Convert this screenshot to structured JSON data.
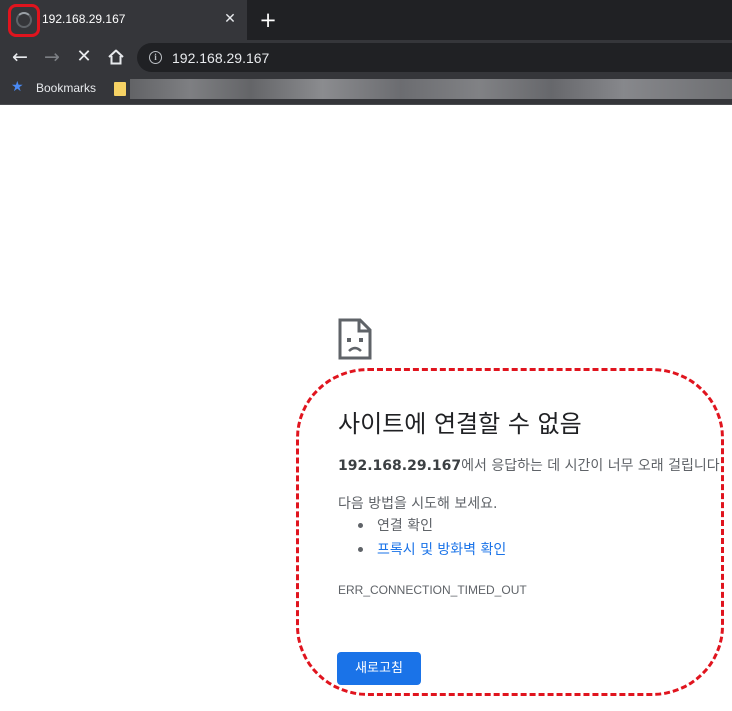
{
  "tab": {
    "title": "192.168.29.167",
    "close_glyph": "✕"
  },
  "new_tab_glyph": "+",
  "toolbar": {
    "back_glyph": "←",
    "forward_glyph": "→",
    "stop_glyph": "✕",
    "home_icon": "home-icon",
    "info_glyph": "i",
    "url": "192.168.29.167"
  },
  "bookmarks": {
    "star_glyph": "★",
    "label": "Bookmarks"
  },
  "error": {
    "icon": "sad-page-icon",
    "title": "사이트에 연결할 수 없음",
    "desc_host": "192.168.29.167",
    "desc_rest": "에서 응답하는 데 시간이 너무 오래 걸립니다.",
    "suggest_heading": "다음 방법을 시도해 보세요.",
    "suggestions": [
      "연결 확인",
      "프록시 및 방화벽 확인"
    ],
    "code": "ERR_CONNECTION_TIMED_OUT",
    "reload_label": "새로고침"
  },
  "colors": {
    "annotation": "#e0141e",
    "link": "#1a73e8",
    "button": "#1a73e8",
    "chrome_dark": "#202124",
    "chrome_tab": "#35363a"
  }
}
